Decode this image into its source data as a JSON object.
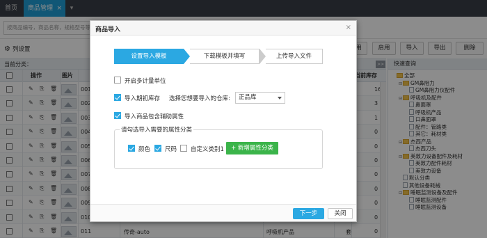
{
  "tabs": {
    "home": "首页",
    "active": "商品管理",
    "close": "×",
    "more": "▾"
  },
  "search": {
    "placeholder": "按商品编号，商品名称，规格型号等查询"
  },
  "toolbar": {
    "column_settings": "列设置",
    "buttons": [
      "用",
      "启用",
      "导入",
      "导出",
      "删除"
    ]
  },
  "category_bar": {
    "label": "当前分类：",
    "toggle": ">>"
  },
  "grid": {
    "headers": {
      "ops": "操作",
      "image": "图片",
      "stock": "当前库存"
    },
    "rows": [
      {
        "code": "001",
        "name": "",
        "category": "",
        "unit": "",
        "stock": "16"
      },
      {
        "code": "002",
        "name": "",
        "category": "",
        "unit": "",
        "stock": "3"
      },
      {
        "code": "003",
        "name": "",
        "category": "",
        "unit": "",
        "stock": "1"
      },
      {
        "code": "004",
        "name": "",
        "category": "",
        "unit": "",
        "stock": "0"
      },
      {
        "code": "005",
        "name": "",
        "category": "",
        "unit": "",
        "stock": "0"
      },
      {
        "code": "006",
        "name": "",
        "category": "",
        "unit": "",
        "stock": "0"
      },
      {
        "code": "007",
        "name": "",
        "category": "",
        "unit": "",
        "stock": "0"
      },
      {
        "code": "008",
        "name": "",
        "category": "",
        "unit": "",
        "stock": "0"
      },
      {
        "code": "009",
        "name": "",
        "category": "",
        "unit": "",
        "stock": "0"
      },
      {
        "code": "010",
        "name": "",
        "category": "",
        "unit": "",
        "stock": "0"
      },
      {
        "code": "011",
        "name": "传奇-auto",
        "category": "呼吸机产品",
        "unit": "套",
        "stock": "0"
      }
    ]
  },
  "right_panel": {
    "title": "快速查询",
    "tree": [
      {
        "label": "全部",
        "type": "folder",
        "level": 0,
        "toggle": ""
      },
      {
        "label": "GM鼻阻力",
        "type": "folder",
        "level": 1,
        "toggle": "⊟"
      },
      {
        "label": "GM鼻阻力仪配件",
        "type": "file",
        "level": 2,
        "toggle": ""
      },
      {
        "label": "呼吸机及配件",
        "type": "folder",
        "level": 1,
        "toggle": "⊟"
      },
      {
        "label": "鼻面罩",
        "type": "file",
        "level": 2,
        "toggle": ""
      },
      {
        "label": "呼吸机产品",
        "type": "file",
        "level": 2,
        "toggle": ""
      },
      {
        "label": "口鼻面罩",
        "type": "file",
        "level": 2,
        "toggle": ""
      },
      {
        "label": "配件：管路类",
        "type": "file",
        "level": 2,
        "toggle": ""
      },
      {
        "label": "其它：耗材类",
        "type": "file",
        "level": 2,
        "toggle": ""
      },
      {
        "label": "杰西产品",
        "type": "folder",
        "level": 1,
        "toggle": "⊟"
      },
      {
        "label": "杰西刀头",
        "type": "file",
        "level": 2,
        "toggle": ""
      },
      {
        "label": "美敦力设备配件及耗材",
        "type": "folder",
        "level": 1,
        "toggle": "⊟"
      },
      {
        "label": "美敦力配件耗材",
        "type": "file",
        "level": 2,
        "toggle": ""
      },
      {
        "label": "美敦力设备",
        "type": "file",
        "level": 2,
        "toggle": ""
      },
      {
        "label": "默认分类",
        "type": "file",
        "level": 1,
        "toggle": ""
      },
      {
        "label": "其他设备耗械",
        "type": "file",
        "level": 1,
        "toggle": ""
      },
      {
        "label": "睡眠监测设备及配件",
        "type": "folder",
        "level": 1,
        "toggle": "⊟"
      },
      {
        "label": "睡眠监测配件",
        "type": "file",
        "level": 2,
        "toggle": ""
      },
      {
        "label": "睡眠监测设备",
        "type": "file",
        "level": 2,
        "toggle": ""
      }
    ]
  },
  "dialog": {
    "title": "商品导入",
    "close": "×",
    "steps": [
      "设置导入模板",
      "下载模板并填写",
      "上传导入文件"
    ],
    "multi_unit": "开启多计量单位",
    "import_stock": "导入期初库存",
    "warehouse_label": "选择您想要导入的仓库:",
    "warehouse_value": "正品库",
    "import_aux": "导入商品包含辅助属性",
    "attr_group_legend": "请勾选导入需要的属性分类",
    "attr_color": "颜色",
    "attr_size": "尺码",
    "attr_custom": "自定义类别1",
    "add_attr_button": "+ 新增属性分类",
    "next_button": "下一步",
    "close_button": "关闭"
  },
  "colors": {
    "accent": "#2ba8e2",
    "green": "#3bb44a",
    "tabbar": "#3a3f47"
  }
}
